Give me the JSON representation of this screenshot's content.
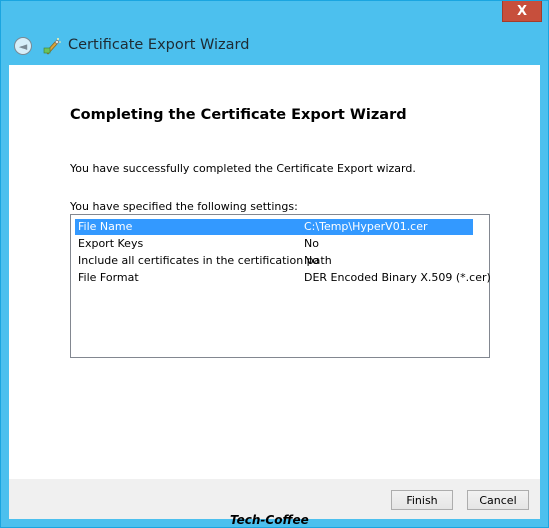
{
  "window": {
    "title": "Certificate Export Wizard",
    "close_glyph": "X",
    "back_glyph": "◄",
    "accent_color": "#4cc0ee",
    "close_color": "#c74f3c"
  },
  "icons": {
    "back": "back-arrow-icon",
    "wizard": "certificate-wizard-icon",
    "close": "close-icon"
  },
  "page": {
    "heading": "Completing the Certificate Export Wizard",
    "success_message": "You have successfully completed the Certificate Export wizard.",
    "settings_label": "You have specified the following settings:"
  },
  "settings": [
    {
      "key": "File Name",
      "value": "C:\\Temp\\HyperV01.cer",
      "selected": true
    },
    {
      "key": "Export Keys",
      "value": "No",
      "selected": false
    },
    {
      "key": "Include all certificates in the certification path",
      "value": "No",
      "selected": false
    },
    {
      "key": "File Format",
      "value": "DER Encoded Binary X.509 (*.cer)",
      "selected": false
    }
  ],
  "buttons": {
    "finish": "Finish",
    "cancel": "Cancel"
  },
  "watermark": "Tech-Coffee"
}
